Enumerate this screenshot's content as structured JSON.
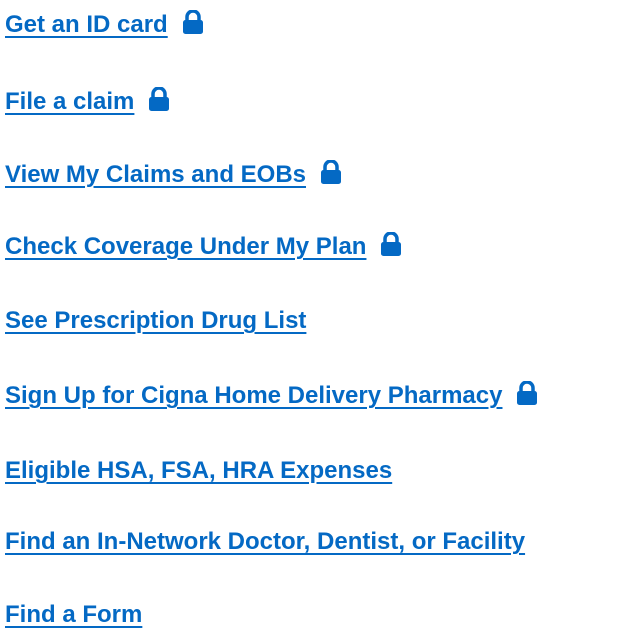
{
  "accent_color": "#0469c4",
  "links": [
    {
      "label": "Get an ID card",
      "locked": true,
      "lock_icon": "lock-icon"
    },
    {
      "label": "File a claim",
      "locked": true,
      "lock_icon": "lock-icon"
    },
    {
      "label": "View My Claims and EOBs",
      "locked": true,
      "lock_icon": "lock-icon"
    },
    {
      "label": "Check Coverage Under My Plan",
      "locked": true,
      "lock_icon": "lock-icon"
    },
    {
      "label": "See Prescription Drug List",
      "locked": false
    },
    {
      "label": "Sign Up for Cigna Home Delivery Pharmacy",
      "locked": true,
      "lock_icon": "lock-icon"
    },
    {
      "label": "Eligible HSA, FSA, HRA Expenses",
      "locked": false
    },
    {
      "label": "Find an In-Network Doctor, Dentist, or Facility",
      "locked": false
    },
    {
      "label": "Find a Form",
      "locked": false
    }
  ]
}
